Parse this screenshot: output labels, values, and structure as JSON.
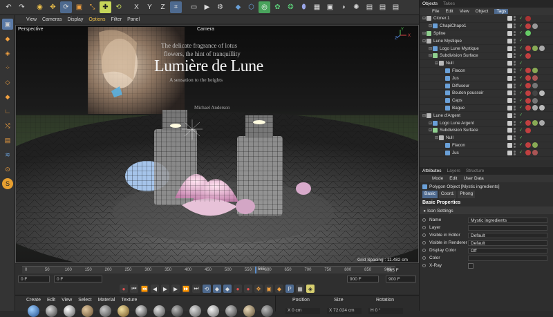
{
  "toolbar": {
    "icons": [
      "undo-icon",
      "redo-icon",
      "live-select-icon",
      "move-icon",
      "rotate-icon",
      "scale-icon",
      "selection-icon",
      "rotate-tool-icon",
      "axis-x-icon",
      "axis-y-icon",
      "axis-z-icon",
      "coordinate-system-icon",
      "render-icon",
      "cube-icon",
      "model-icon",
      "null-icon",
      "cloner-icon",
      "sphere-icon",
      "deformer-icon",
      "grid-icon",
      "scene-icon",
      "camera-icon",
      "light-icon",
      "clapper-icon",
      "clapper-icon",
      "clapper-icon"
    ],
    "axis_labels": {
      "x": "X",
      "y": "Y",
      "z": "Z"
    }
  },
  "viewport_menu": {
    "items": [
      "View",
      "Cameras",
      "Display",
      "Options",
      "Filter",
      "Panel"
    ],
    "highlight_index": 3
  },
  "viewport": {
    "label_perspective": "Perspective",
    "label_camera": "Camera",
    "grid_spacing": "Grid Spacing : 11.482 cm",
    "axis_labels": {
      "y": "Y",
      "x": "X",
      "z": "Z"
    },
    "poster": {
      "line1": "The delicate fragrance of lotus",
      "line2": "flowers, the hint of tranquillity",
      "title": "Lumière de Lune",
      "line3": "A sensation to the heights",
      "line4": "Michael Anderson"
    }
  },
  "timeline": {
    "ticks": [
      "0",
      "50",
      "100",
      "150",
      "200",
      "250",
      "300",
      "350",
      "400",
      "450",
      "500",
      "550",
      "600",
      "650",
      "700",
      "750",
      "800",
      "850",
      "900"
    ],
    "playhead_label": "565",
    "frame_end": "565 F",
    "start": "0 F",
    "start2": "0 F",
    "end": "900 F",
    "end2": "900 F"
  },
  "transport": {
    "icons": [
      "record-icon",
      "go-start-icon",
      "prev-key-icon",
      "prev-frame-icon",
      "play-icon",
      "next-frame-icon",
      "next-key-icon",
      "go-end-icon",
      "loop-icon",
      "key-icon",
      "key-icon",
      "key-icon",
      "record-icon",
      "move-icon",
      "scale-icon",
      "key-icon",
      "p-icon",
      "grid-icon",
      "keyframe-icon"
    ]
  },
  "material_manager": {
    "menu": [
      "Create",
      "Edit",
      "View",
      "Select",
      "Material",
      "Texture"
    ],
    "coord_headers": {
      "position": "Position",
      "size": "Size",
      "rotation": "Rotation"
    },
    "coord_values": {
      "x_pos": "X  0 cm",
      "x_size": "X  72.024 cm",
      "h_rot": "H  0 °"
    }
  },
  "objects_panel": {
    "tabs": [
      "Objects",
      "Takes"
    ],
    "menu": [
      "File",
      "Edit",
      "View",
      "Object",
      "Tags"
    ],
    "active_menu_index": 4,
    "rows": [
      {
        "name": "Cloner.1",
        "indent": 0,
        "color": "#b8b8b8",
        "tags": [
          "#aa3333"
        ]
      },
      {
        "name": "ChapiChapo1",
        "indent": 1,
        "color": "#6aa0d8",
        "tags": [
          "#c04040",
          "#999"
        ]
      },
      {
        "name": "Spline",
        "indent": 0,
        "color": "#8fd08f",
        "tags": [
          "#6c6"
        ]
      },
      {
        "name": "Lune Mystique",
        "indent": 0,
        "color": "#b8b8b8",
        "tags": []
      },
      {
        "name": "Logo Lune Mystique",
        "indent": 1,
        "color": "#6aa0d8",
        "tags": [
          "#c04040",
          "#8a5",
          "#aaa"
        ]
      },
      {
        "name": "Subdivision Surface",
        "indent": 1,
        "color": "#8fd08f",
        "tags": [
          "#c04040"
        ]
      },
      {
        "name": "Null",
        "indent": 2,
        "color": "#b8b8b8",
        "tags": []
      },
      {
        "name": "Flacon",
        "indent": 3,
        "color": "#6aa0d8",
        "tags": [
          "#c04040",
          "#8a5"
        ]
      },
      {
        "name": "Jus",
        "indent": 3,
        "color": "#6aa0d8",
        "tags": [
          "#c04040",
          "#a55"
        ]
      },
      {
        "name": "Diffuseur",
        "indent": 3,
        "color": "#6aa0d8",
        "tags": [
          "#c04040",
          "#777"
        ]
      },
      {
        "name": "Bouton poussoir",
        "indent": 3,
        "color": "#6aa0d8",
        "tags": [
          "#c04040",
          "#444",
          "#bbb"
        ]
      },
      {
        "name": "Caps",
        "indent": 3,
        "color": "#6aa0d8",
        "tags": [
          "#c04040",
          "#777"
        ]
      },
      {
        "name": "Bague",
        "indent": 3,
        "color": "#6aa0d8",
        "tags": [
          "#c04040",
          "#aaa",
          "#bbb"
        ]
      },
      {
        "name": "Lune d'Argent",
        "indent": 0,
        "color": "#b8b8b8",
        "tags": []
      },
      {
        "name": "Logo Lune Argent",
        "indent": 1,
        "color": "#6aa0d8",
        "tags": [
          "#c04040",
          "#8a5",
          "#aaa"
        ]
      },
      {
        "name": "Subdivision Surface",
        "indent": 1,
        "color": "#8fd08f",
        "tags": [
          "#c04040"
        ]
      },
      {
        "name": "Null",
        "indent": 2,
        "color": "#b8b8b8",
        "tags": []
      },
      {
        "name": "Flacon",
        "indent": 3,
        "color": "#6aa0d8",
        "tags": [
          "#c04040",
          "#8a5"
        ]
      },
      {
        "name": "Jus",
        "indent": 3,
        "color": "#6aa0d8",
        "tags": [
          "#c04040",
          "#a55"
        ]
      }
    ]
  },
  "attributes_panel": {
    "tabs": [
      "Attributes",
      "Layers",
      "Structure"
    ],
    "menu": [
      "Mode",
      "Edit",
      "User Data"
    ],
    "object_title": "Polygon Object [Mystic ingredients]",
    "subtabs": [
      "Basic",
      "Coord.",
      "Phong"
    ],
    "section": "Basic Properties",
    "icon_settings": "Icon Settings",
    "fields": [
      {
        "label": "Name",
        "value": "Mystic ingredients"
      },
      {
        "label": "Layer",
        "value": ""
      },
      {
        "label": "Visible in Editor",
        "value": "Default"
      },
      {
        "label": "Visible in Renderer",
        "value": "Default"
      },
      {
        "label": "Display Color",
        "value": "Off"
      },
      {
        "label": "Color",
        "value": ""
      },
      {
        "label": "X-Ray",
        "value": ""
      }
    ]
  },
  "colors": {
    "accent": "#4e6a8f",
    "highlight_text": "#f0c24a",
    "panel_bg": "#2e2e2e"
  }
}
